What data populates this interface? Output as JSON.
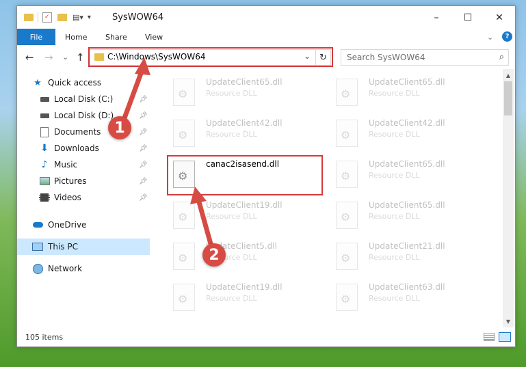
{
  "window": {
    "title": "SysWOW64",
    "controls": {
      "minimize": "–",
      "maximize": "☐",
      "close": "✕"
    }
  },
  "ribbon": {
    "tabs": [
      "File",
      "Home",
      "Share",
      "View"
    ],
    "collapse_glyph": "⌄",
    "help_glyph": "?"
  },
  "navigation": {
    "back": "←",
    "forward": "→",
    "recent": "⌄",
    "up": "↑",
    "address": "C:\\Windows\\SysWOW64",
    "address_dropdown": "⌄",
    "refresh": "↻",
    "search_placeholder": "Search SysWOW64",
    "search_glyph": "⌕"
  },
  "sidebar": {
    "items": [
      {
        "label": "Quick access",
        "icon": "star-icon"
      },
      {
        "label": "Local Disk (C:)",
        "icon": "drive-icon",
        "pinned": true
      },
      {
        "label": "Local Disk (D:)",
        "icon": "drive-icon",
        "pinned": true
      },
      {
        "label": "Documents",
        "icon": "documents-icon",
        "pinned": true
      },
      {
        "label": "Downloads",
        "icon": "downloads-icon",
        "pinned": true
      },
      {
        "label": "Music",
        "icon": "music-icon",
        "pinned": true
      },
      {
        "label": "Pictures",
        "icon": "pictures-icon",
        "pinned": true
      },
      {
        "label": "Videos",
        "icon": "videos-icon",
        "pinned": true
      },
      {
        "label": "OneDrive",
        "icon": "onedrive-icon"
      },
      {
        "label": "This PC",
        "icon": "computer-icon",
        "selected": true
      },
      {
        "label": "Network",
        "icon": "network-icon"
      }
    ]
  },
  "files": [
    {
      "name": "UpdateClient65.dll",
      "type": "Resource DLL"
    },
    {
      "name": "UpdateClient65.dll",
      "type": "Resource DLL"
    },
    {
      "name": "UpdateClient42.dll",
      "type": "Resource DLL"
    },
    {
      "name": "UpdateClient42.dll",
      "type": "Resource DLL"
    },
    {
      "name": "canac2isasend.dll",
      "type": "",
      "highlighted": true
    },
    {
      "name": "UpdateClient65.dll",
      "type": "Resource DLL"
    },
    {
      "name": "UpdateClient19.dll",
      "type": "Resource DLL"
    },
    {
      "name": "UpdateClient65.dll",
      "type": "Resource DLL"
    },
    {
      "name": "UpdateClient5.dll",
      "type": "Resource DLL"
    },
    {
      "name": "UpdateClient21.dll",
      "type": "Resource DLL"
    },
    {
      "name": "UpdateClient19.dll",
      "type": "Resource DLL"
    },
    {
      "name": "UpdateClient63.dll",
      "type": "Resource DLL"
    }
  ],
  "status": {
    "item_count": "105 items"
  },
  "annotations": {
    "marker_1": "1",
    "marker_2": "2",
    "color": "#d64b43"
  },
  "colors": {
    "accent": "#1979ca",
    "selection": "#cce8ff",
    "highlight_box": "#d43a3a"
  }
}
